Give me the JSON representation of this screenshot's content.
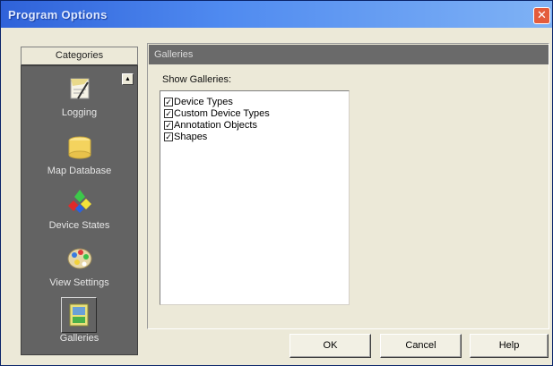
{
  "window": {
    "title": "Program Options",
    "close_glyph": "✕"
  },
  "categories": {
    "header": "Categories",
    "scroll_up_glyph": "▲",
    "items": [
      {
        "label": "Logging",
        "icon": "logging-icon"
      },
      {
        "label": "Map Database",
        "icon": "map-database-icon"
      },
      {
        "label": "Device States",
        "icon": "device-states-icon"
      },
      {
        "label": "View Settings",
        "icon": "view-settings-icon"
      },
      {
        "label": "Galleries",
        "icon": "galleries-icon",
        "selected": true
      }
    ]
  },
  "galleries": {
    "header": "Galleries",
    "show_label": "Show Galleries:",
    "items": [
      {
        "label": "Device Types",
        "checked": true
      },
      {
        "label": "Custom Device Types",
        "checked": true
      },
      {
        "label": "Annotation Objects",
        "checked": true
      },
      {
        "label": "Shapes",
        "checked": true
      }
    ],
    "check_glyph": "✓"
  },
  "buttons": {
    "ok": "OK",
    "cancel": "Cancel",
    "help": "Help"
  },
  "colors": {
    "titlebar": "#2f62d9",
    "sidebar": "#636363",
    "panel_header": "#6a6a6a",
    "face": "#ece9d8"
  }
}
